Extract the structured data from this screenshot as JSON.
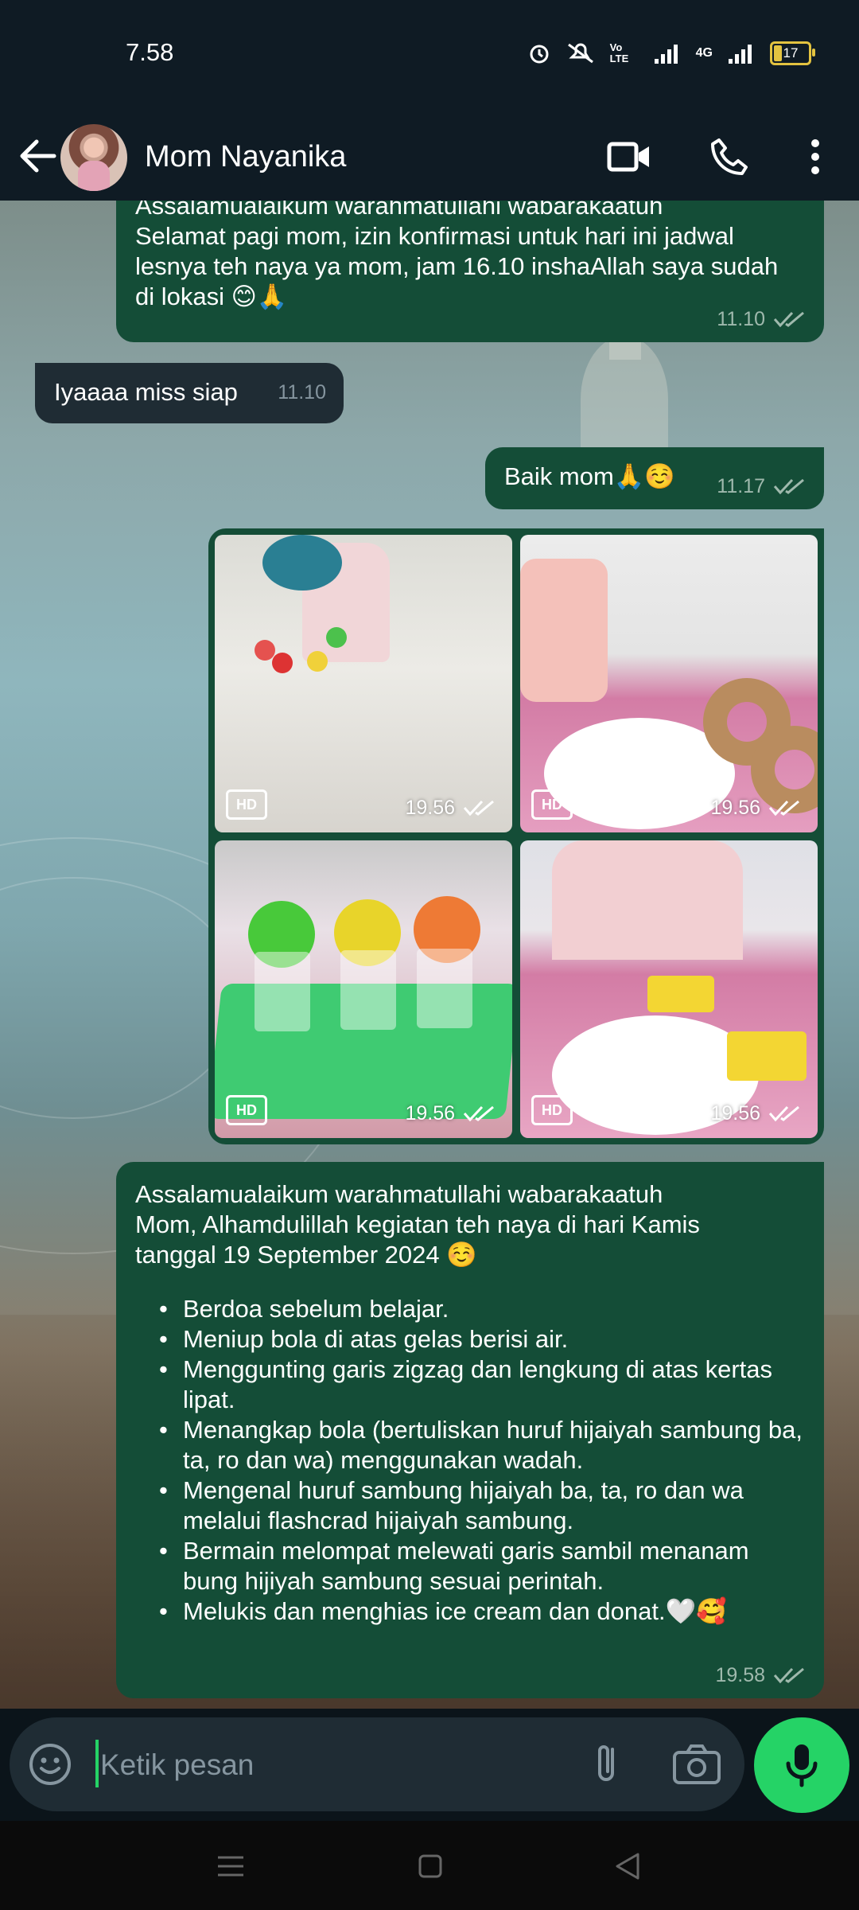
{
  "status_bar": {
    "time": "7.58",
    "volte": "Vo LTE",
    "network": "4G",
    "battery": "17"
  },
  "header": {
    "contact_name": "Mom Nayanika"
  },
  "messages": [
    {
      "direction": "out",
      "lines": [
        "Assalamualaikum warahmatullahi wabarakaatuh",
        "Selamat pagi mom, izin konfirmasi untuk hari ini jadwal lesnya teh naya ya mom, jam 16.10 inshaAllah saya sudah di lokasi 😊🙏"
      ],
      "time": "11.10"
    },
    {
      "direction": "in",
      "text": "Iyaaaa miss siap",
      "time": "11.10"
    },
    {
      "direction": "out",
      "text": "Baik mom🙏☺️",
      "time": "11.17"
    },
    {
      "direction": "out",
      "type": "album",
      "photos": [
        {
          "badge": "HD",
          "time": "19.56"
        },
        {
          "badge": "HD",
          "time": "19.56"
        },
        {
          "badge": "HD",
          "time": "19.56"
        },
        {
          "badge": "HD",
          "time": "19.56"
        }
      ]
    },
    {
      "direction": "out",
      "intro": [
        "Assalamualaikum warahmatullahi wabarakaatuh",
        "Mom, Alhamdulillah kegiatan teh naya di hari Kamis tanggal 19 September 2024 ☺️"
      ],
      "items": [
        "Berdoa sebelum belajar.",
        "Meniup bola di atas gelas berisi air.",
        "Menggunting garis zigzag dan lengkung di atas kertas lipat.",
        "Menangkap bola (bertuliskan huruf hijaiyah sambung ba, ta, ro dan wa) menggunakan wadah.",
        "Mengenal huruf sambung hijaiyah ba, ta, ro dan wa melalui flashcrad hijaiyah sambung.",
        "Bermain melompat melewati garis sambil menanam bung hijiyah sambung sesuai perintah.",
        "Melukis dan menghias ice cream dan donat.🤍🥰"
      ],
      "time": "19.58"
    }
  ],
  "composer": {
    "placeholder": "Ketik pesan"
  },
  "icons": {
    "back": "arrow-left-icon",
    "video": "video-camera-icon",
    "call": "phone-icon",
    "more": "more-vertical-icon",
    "emoji": "emoji-icon",
    "attach": "paperclip-icon",
    "camera": "camera-icon",
    "mic": "microphone-icon"
  },
  "colors": {
    "outgoing_bubble": "#144d37",
    "incoming_bubble": "#1f2c34",
    "accent": "#25d366",
    "header": "#0f1b24"
  }
}
